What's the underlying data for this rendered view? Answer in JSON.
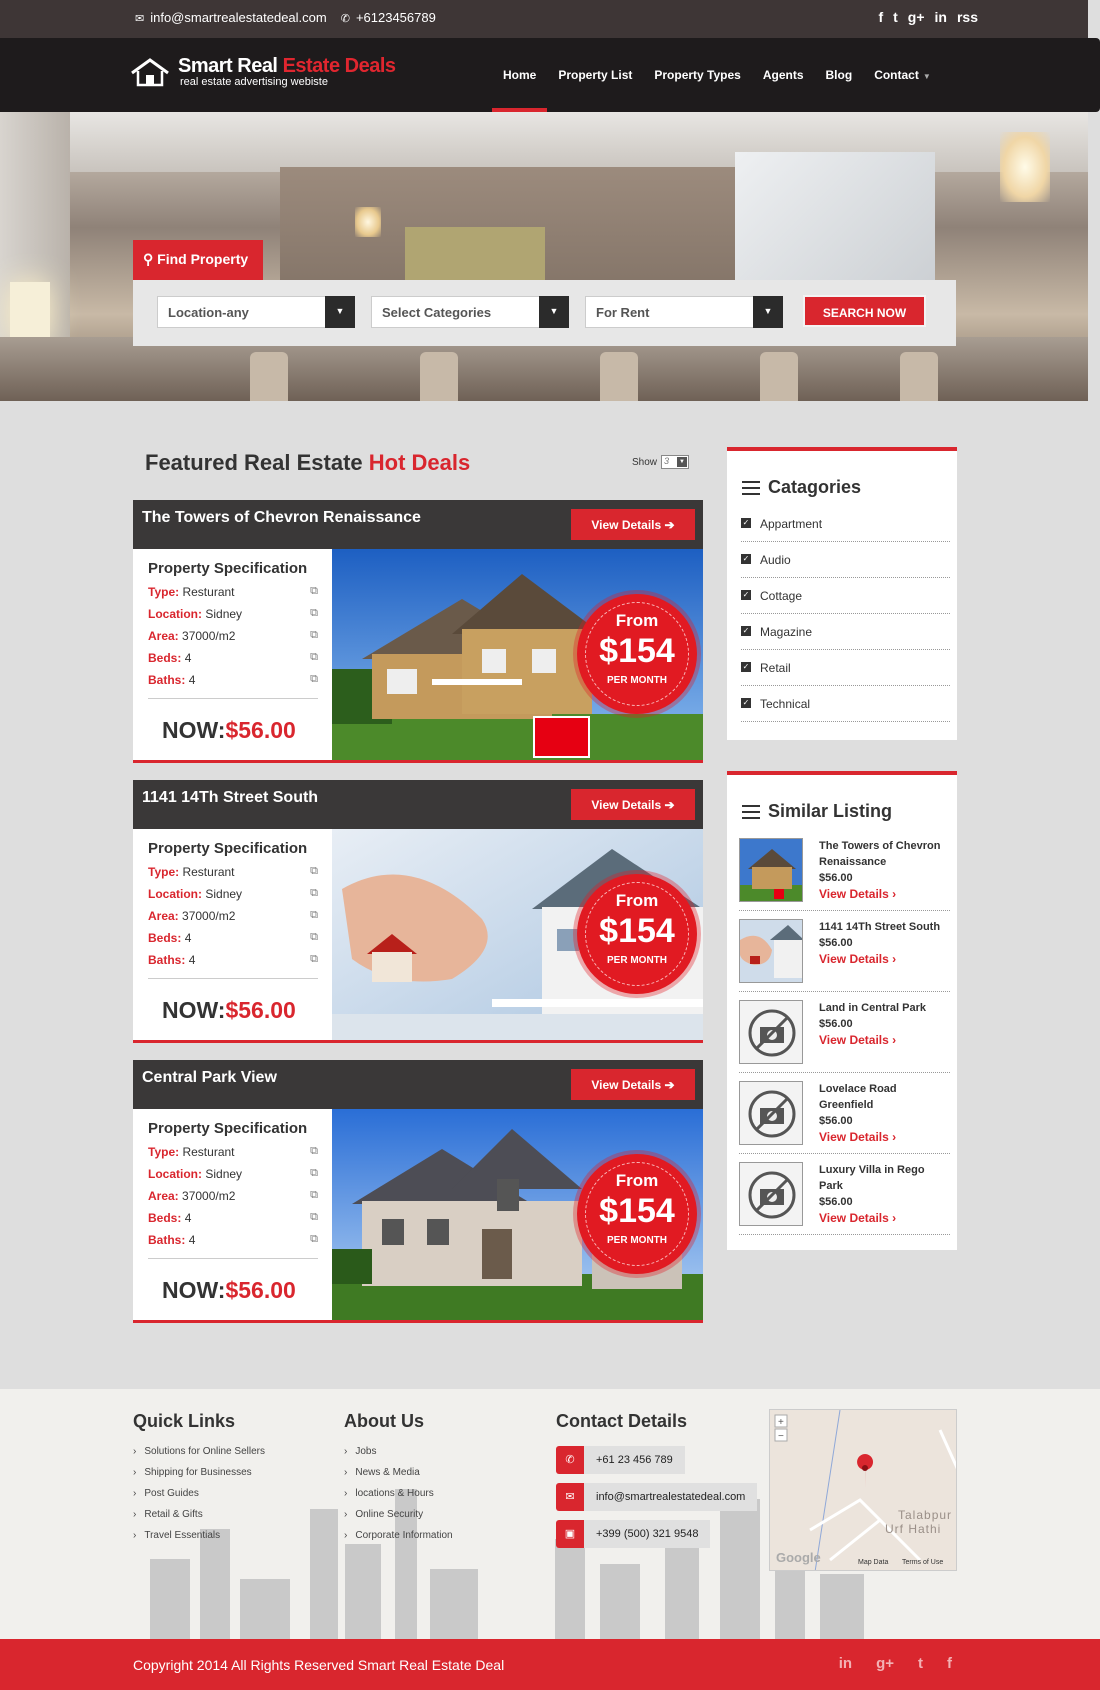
{
  "topbar": {
    "email": "info@smartrealestatedeal.com",
    "phone": "+6123456789",
    "social": [
      "f",
      "t",
      "g+",
      "in",
      "rss"
    ]
  },
  "brand": {
    "title_white": "Smart Real ",
    "title_red": "Estate Deals",
    "subtitle": "real estate advertising webiste"
  },
  "nav": {
    "items": [
      "Home",
      "Property List",
      "Property Types",
      "Agents",
      "Blog",
      "Contact"
    ],
    "active": "Home"
  },
  "search": {
    "tab_label": "Find Property",
    "location": "Location-any",
    "category": "Select Categories",
    "status": "For Rent",
    "button": "SEARCH NOW"
  },
  "featured": {
    "heading_dark": "Featured Real Estate ",
    "heading_red": "Hot Deals",
    "show_label": "Show",
    "show_value": "3",
    "spec_title": "Property Specification",
    "view_details": "View Details",
    "badge_from": "From",
    "badge_price": "$154",
    "badge_period": "PER MONTH",
    "now_label": "NOW:",
    "labels": {
      "type": "Type:",
      "location": "Location:",
      "area": "Area:",
      "beds": "Beds:",
      "baths": "Baths:"
    },
    "listings": [
      {
        "title": "The Towers of Chevron Renaissance",
        "type": "Resturant",
        "location": "Sidney",
        "area": "37000/m2",
        "beds": "4",
        "baths": "4",
        "now": "$56.00"
      },
      {
        "title": "1141 14Th Street South",
        "type": "Resturant",
        "location": "Sidney",
        "area": "37000/m2",
        "beds": "4",
        "baths": "4",
        "now": "$56.00"
      },
      {
        "title": "Central Park View",
        "type": "Resturant",
        "location": "Sidney",
        "area": "37000/m2",
        "beds": "4",
        "baths": "4",
        "now": "$56.00"
      }
    ]
  },
  "categories": {
    "title": "Catagories",
    "items": [
      "Appartment",
      "Audio",
      "Cottage",
      "Magazine",
      "Retail",
      "Technical"
    ]
  },
  "similar": {
    "title": "Similar Listing",
    "view_details": "View Details",
    "items": [
      {
        "title": "The Towers of Chevron Renaissance",
        "price": "$56.00"
      },
      {
        "title": "1141 14Th Street South",
        "price": "$56.00"
      },
      {
        "title": "Land in Central Park",
        "price": "$56.00"
      },
      {
        "title": "Lovelace Road Greenfield",
        "price": "$56.00"
      },
      {
        "title": "Luxury Villa in Rego Park",
        "price": "$56.00"
      }
    ]
  },
  "footer": {
    "quick_links": {
      "title": "Quick Links",
      "items": [
        "Solutions for Online Sellers",
        "Shipping for Businesses",
        "Post Guides",
        "Retail & Gifts",
        "Travel Essentials"
      ]
    },
    "about": {
      "title": "About Us",
      "items": [
        "Jobs",
        "News & Media",
        "locations & Hours",
        "Online Security",
        "Corporate Information"
      ]
    },
    "contact": {
      "title": "Contact Details",
      "phone": "+61 23 456 789",
      "email": "info@smartrealestatedeal.com",
      "fax": "+399 (500) 321 9548"
    },
    "map": {
      "place": "Talabpur",
      "place2": "Urf Hathi",
      "provider": "Google",
      "map_data": "Map Data",
      "terms": "Terms of Use"
    }
  },
  "copyright": {
    "text": "Copyright 2014 All Rights Reserved Smart Real Estate Deal",
    "social": [
      "in",
      "g+",
      "t",
      "f"
    ]
  },
  "colors": {
    "accent": "#d9262e",
    "dark": "#3a3838"
  }
}
